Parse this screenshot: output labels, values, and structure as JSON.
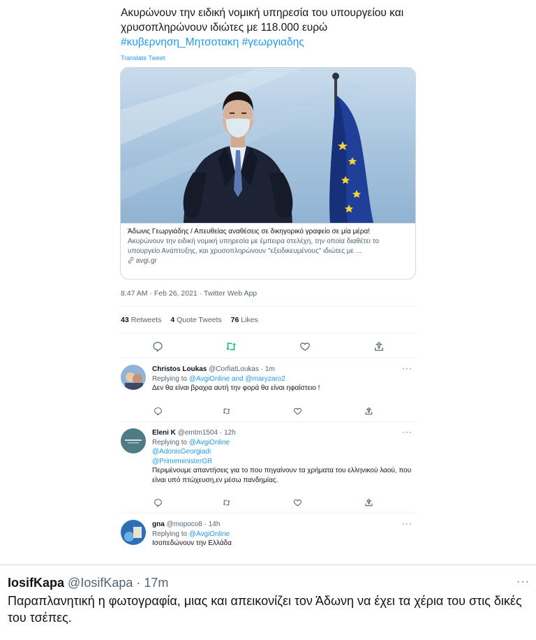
{
  "main_tweet": {
    "text": "Ακυρώνουν την ειδική νομική υπηρεσία του υπουργείου  και χρυσοπληρώνουν ιδιώτες με 118.000 ευρώ",
    "hashtag1": "#κυβερνηση_Μητσοτακη",
    "hashtag2": "#γεωργιαδης",
    "translate_label": "Translate Tweet",
    "card": {
      "title": "Άδωνις Γεωργιάδης / Απευθείας αναθέσεις σε δικηγορικό γραφείο σε μία μέρα!",
      "description": "Ακυρώνουν την ειδική νομική υπηρεσία με έμπειρα στελέχη, την οποία διαθέτει το υπουργείο Ανάπτυξης, και χρυσοπληρώνουν \"εξειδικευμένους\" ιδιώτες με ...",
      "domain": "avgi.gr",
      "link_icon": "link-icon"
    },
    "timestamp": "8:47 AM · Feb 26, 2021 · Twitter Web App",
    "stats": {
      "retweets_count": "43",
      "retweets_label": "Retweets",
      "quotes_count": "4",
      "quotes_label": "Quote Tweets",
      "likes_count": "76",
      "likes_label": "Likes"
    }
  },
  "replies": [
    {
      "name": "Christos Loukas",
      "handle": "@CorfiatLoukas · 1m",
      "replying_prefix": "Replying to ",
      "replying_to": "@AvgiOnline and @maryzaro2",
      "mentions": [],
      "text": "Δεν θα είναι βραχια αυτή την φορά θα είναι ηφαίστειο !"
    },
    {
      "name": "Eleni K",
      "handle": "@emtm1504 · 12h",
      "replying_prefix": "Replying to ",
      "replying_to": "@AvgiOnline",
      "mentions": [
        "@AdonisGeorgiadi",
        "@PrimeministerGR"
      ],
      "text": "Περιμένουμε απαντήσεις για το που πηγαίνουν τα χρήματα του ελληνικού λαού, που είναι υπό πτώχευση,εν μέσω πανδημίας."
    },
    {
      "name": "gna",
      "handle": "@mopoco8 · 14h",
      "replying_prefix": "Replying to ",
      "replying_to": "@AvgiOnline",
      "mentions": [],
      "text": "Ισοπεδώνουν την Ελλάδα"
    }
  ],
  "bottom_tweet": {
    "name": "IosifKapa",
    "handle": "@IosifKapa · 17m",
    "text": "Παραπλανητική η φωτογραφία, μιας και απεικονίζει τον Άδωνη να έχει τα χέρια του στις δικές του τσέπες."
  },
  "more_glyph": "···",
  "colors": {
    "link": "#1d9bf0",
    "retweet_active": "#00ba7c",
    "secondary_text": "#536471",
    "border": "#cfd9de"
  }
}
